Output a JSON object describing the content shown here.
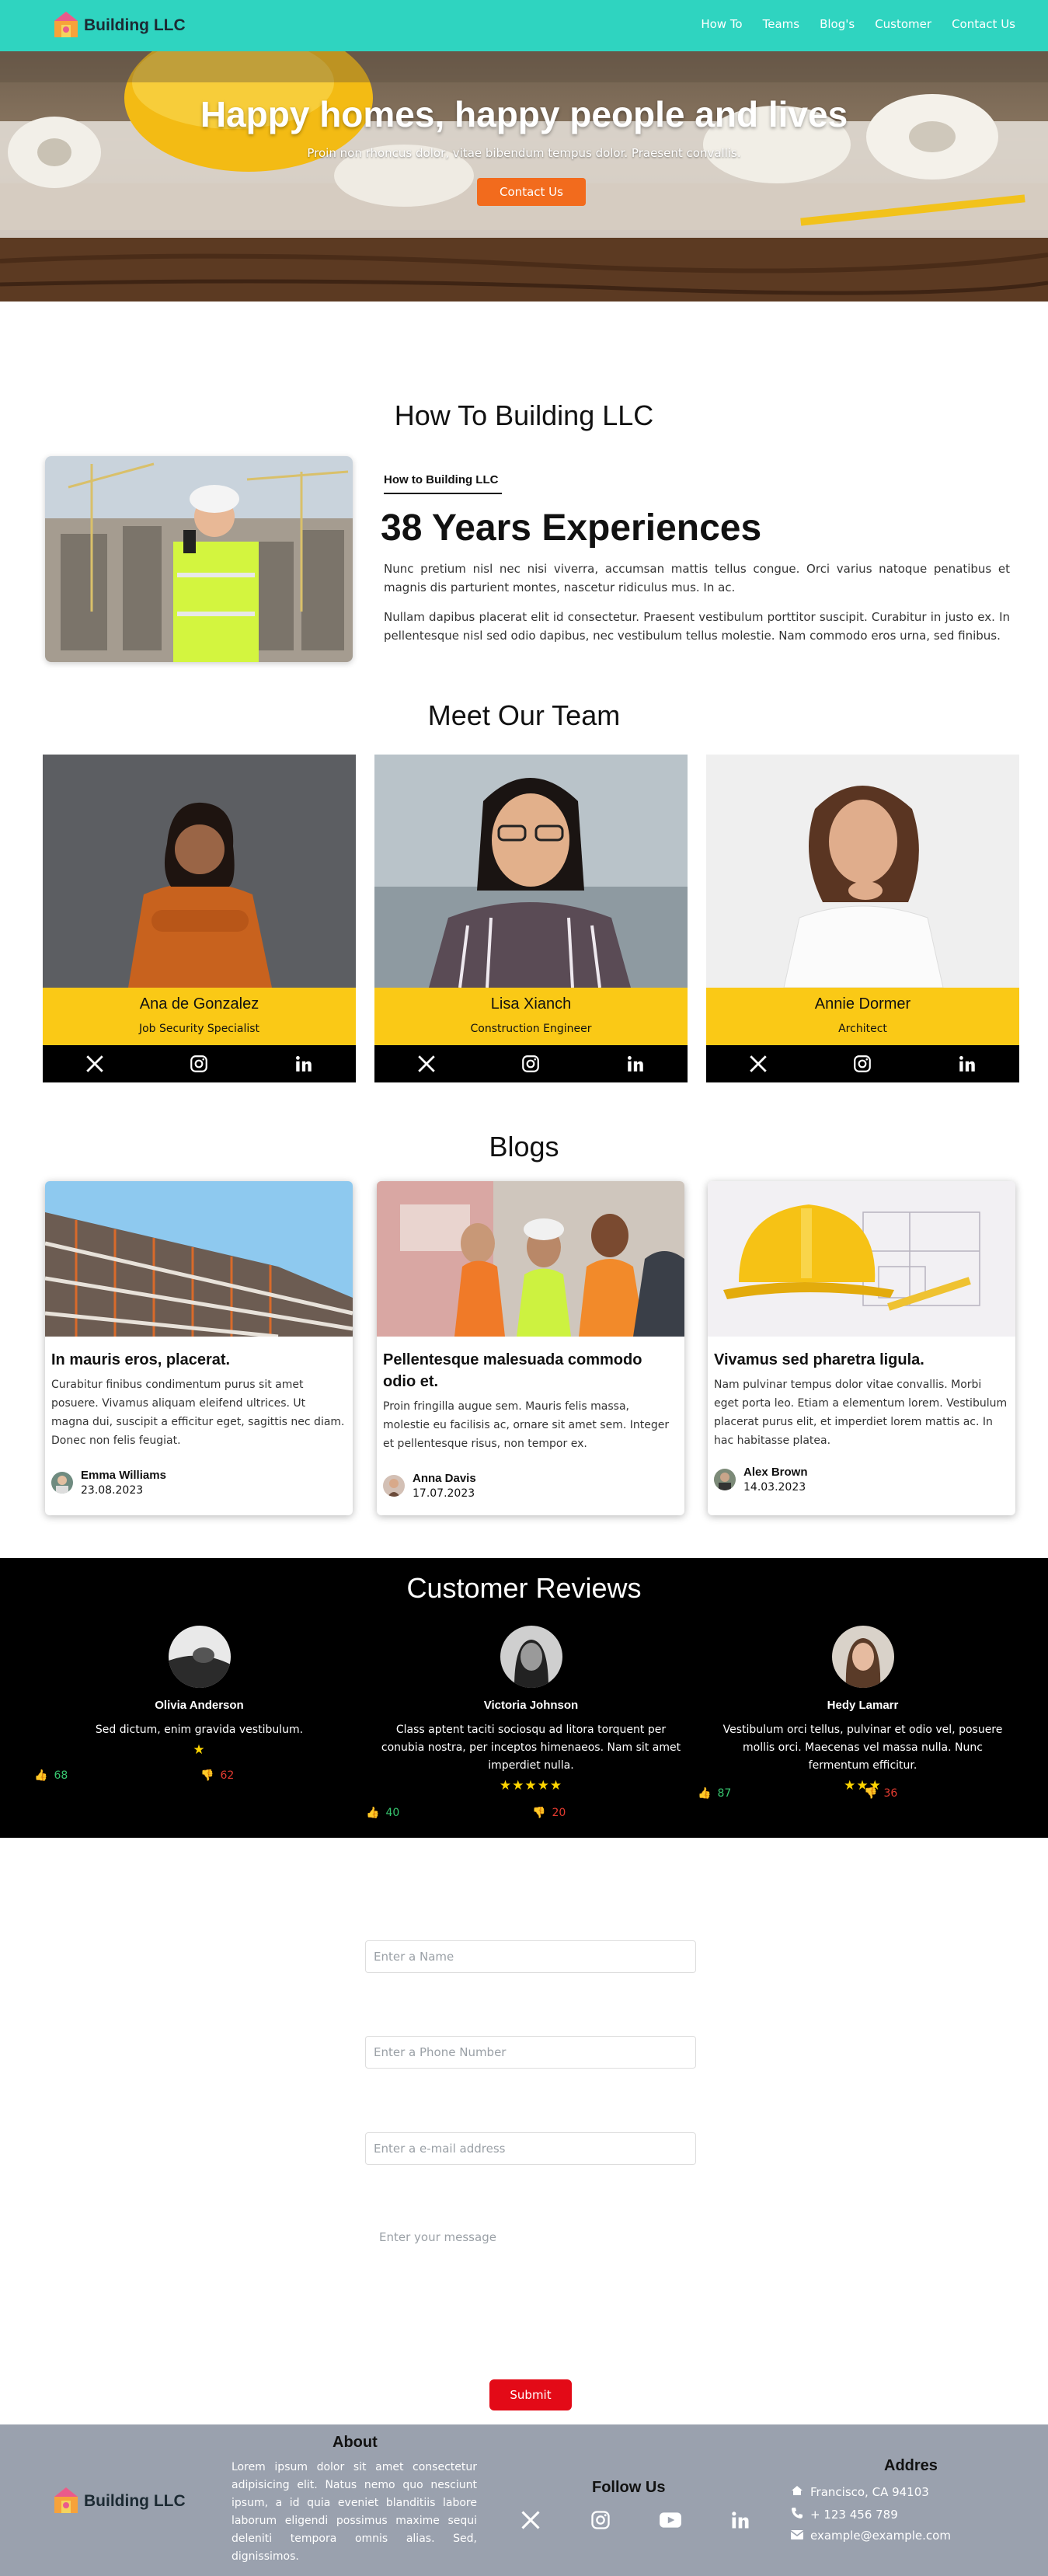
{
  "brand": {
    "name": "Building LLC",
    "accent": "#2fd4c0"
  },
  "nav": {
    "links": [
      "How To",
      "Teams",
      "Blog's",
      "Customer",
      "Contact Us"
    ]
  },
  "hero": {
    "title": "Happy homes, happy people and lives",
    "subtitle": "Proin non rhoncus dolor, vitae bibendum tempus dolor. Praesent convallis.",
    "button": "Contact Us",
    "button_color": "#f26b1d"
  },
  "howto": {
    "section_title": "How To Building LLC",
    "kicker": "How to Building LLC",
    "heading": "38 Years Experiences",
    "p1": "Nunc pretium nisl nec nisi viverra, accumsan mattis tellus congue. Orci varius natoque penatibus et magnis dis parturient montes, nascetur ridiculus mus. In ac.",
    "p2": "Nullam dapibus placerat elit id consectetur. Praesent vestibulum porttitor suscipit. Curabitur in justo ex. In pellentesque nisl sed odio dapibus, nec vestibulum tellus molestie. Nam commodo eros urna, sed finibus."
  },
  "team": {
    "section_title": "Meet Our Team",
    "card_color": "#fac916",
    "members": [
      {
        "name": "Ana de Gonzalez",
        "role": "Job Security Specialist"
      },
      {
        "name": "Lisa Xianch",
        "role": "Construction Engineer"
      },
      {
        "name": "Annie Dormer",
        "role": "Architect"
      }
    ],
    "social_icons": [
      "x-icon",
      "instagram-icon",
      "linkedin-icon"
    ]
  },
  "blogs": {
    "section_title": "Blogs",
    "posts": [
      {
        "title": "In mauris eros, placerat.",
        "text": "Curabitur finibus condimentum purus sit amet posuere. Vivamus aliquam eleifend ultrices. Ut magna dui, suscipit a efficitur eget, sagittis nec diam. Donec non felis feugiat.",
        "author": "Emma Williams",
        "date": "23.08.2023"
      },
      {
        "title": "Pellentesque malesuada commodo odio et.",
        "text": "Proin fringilla augue sem. Mauris felis massa, molestie eu facilisis ac, ornare sit amet sem. Integer et pellentesque risus, non tempor ex.",
        "author": "Anna Davis",
        "date": "17.07.2023"
      },
      {
        "title": "Vivamus sed pharetra ligula.",
        "text": "Nam pulvinar tempus dolor vitae convallis. Morbi eget porta leo. Etiam a elementum lorem. Vestibulum placerat purus elit, et imperdiet lorem mattis ac. In hac habitasse platea.",
        "author": "Alex Brown",
        "date": "14.03.2023"
      }
    ]
  },
  "reviews": {
    "section_title": "Customer Reviews",
    "items": [
      {
        "name": "Olivia Anderson",
        "text": "Sed dictum, enim gravida vestibulum.",
        "stars": "★",
        "rating": 1,
        "likes": "68",
        "dislikes": "62"
      },
      {
        "name": "Victoria Johnson",
        "text": "Class aptent taciti sociosqu ad litora torquent per conubia nostra, per inceptos himenaeos. Nam sit amet imperdiet nulla.",
        "stars": "★★★★★",
        "rating": 5,
        "likes": "40",
        "dislikes": "20"
      },
      {
        "name": "Hedy Lamarr",
        "text": "Vestibulum orci tellus, pulvinar et odio vel, posuere mollis orci. Maecenas vel massa nulla. Nunc fermentum efficitur.",
        "stars": "★★★",
        "rating": 3,
        "likes": "87",
        "dislikes": "36"
      }
    ]
  },
  "form": {
    "name_placeholder": "Enter a Name",
    "phone_placeholder": "Enter a Phone Number",
    "email_placeholder": "Enter a e-mail address",
    "message_placeholder": "Enter your message",
    "submit": "Submit",
    "submit_color": "#e30a17"
  },
  "footer": {
    "about_title": "About",
    "about_text": "Lorem ipsum dolor sit amet consectetur adipisicing elit. Natus nemo quo nesciunt ipsum, a id quia eveniet blanditiis labore laborum eligendi possimus maxime sequi deleniti tempora omnis alias. Sed, dignissimos.",
    "follow_title": "Follow Us",
    "social_icons": [
      "x-icon",
      "instagram-icon",
      "youtube-icon",
      "linkedin-icon"
    ],
    "address_title": "Addres",
    "address": "Francisco, CA 94103",
    "phone": "+ 123 456 789",
    "email": "example@example.com"
  }
}
